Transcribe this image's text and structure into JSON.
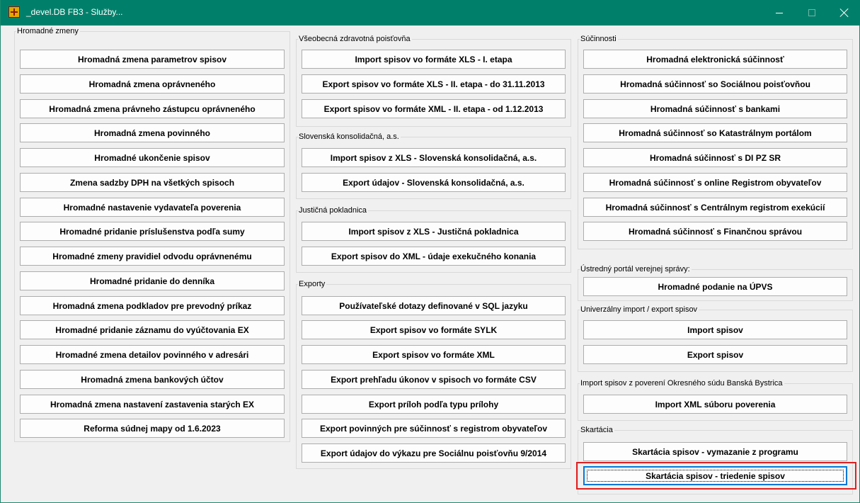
{
  "window": {
    "title": "_devel.DB FB3 - Služby..."
  },
  "groups": {
    "hromadne": {
      "label": "Hromadné zmeny",
      "buttons": [
        "Hromadná zmena parametrov spisov",
        "Hromadná zmena oprávneného",
        "Hromadná zmena právneho zástupcu oprávneného",
        "Hromadná zmena povinného",
        "Hromadné ukončenie spisov",
        "Zmena sadzby DPH na všetkých spisoch",
        "Hromadné nastavenie vydavateľa poverenia",
        "Hromadné pridanie príslušenstva podľa sumy",
        "Hromadné zmeny pravidiel odvodu oprávnenému",
        "Hromadné pridanie do denníka",
        "Hromadná zmena podkladov pre prevodný príkaz",
        "Hromadné pridanie záznamu do vyúčtovania EX",
        "Hromadné zmena detailov povinného v adresári",
        "Hromadná zmena bankových účtov",
        "Hromadná zmena nastavení zastavenia starých EX",
        "Reforma súdnej mapy od 1.6.2023"
      ]
    },
    "vszp": {
      "label": "Všeobecná zdravotná poisťovňa",
      "buttons": [
        "Import spisov vo formáte XLS - I. etapa",
        "Export spisov vo formáte XLS - II. etapa - do 31.11.2013",
        "Export spisov vo formáte XML - II. etapa - od 1.12.2013"
      ]
    },
    "sk": {
      "label": "Slovenská konsolidačná, a.s.",
      "buttons": [
        "Import spisov z XLS - Slovenská konsolidačná, a.s.",
        "Export údajov - Slovenská konsolidačná, a.s."
      ]
    },
    "jp": {
      "label": "Justičná pokladnica",
      "buttons": [
        "Import spisov z XLS - Justičná pokladnica",
        "Export spisov do XML - údaje exekučného konania"
      ]
    },
    "exporty": {
      "label": "Exporty",
      "buttons": [
        "Používateľské dotazy definované v SQL jazyku",
        "Export spisov vo formáte SYLK",
        "Export spisov vo formáte XML",
        "Export prehľadu úkonov v spisoch vo formáte CSV",
        "Export príloh podľa typu prílohy",
        "Export povinných pre súčinnosť s registrom obyvateľov",
        "Export údajov do výkazu pre Sociálnu poisťovňu 9/2014"
      ]
    },
    "sucinnosti": {
      "label": "Súčinnosti",
      "buttons": [
        "Hromadná elektronická súčinnosť",
        "Hromadná súčinnosť so Sociálnou poisťovňou",
        "Hromadná súčinnosť s bankami",
        "Hromadná súčinnosť so Katastrálnym portálom",
        "Hromadná súčinnosť s DI PZ SR",
        "Hromadná súčinnosť s online Registrom obyvateľov",
        "Hromadná súčinnosť s Centrálnym registrom exekúcií",
        "Hromadná súčinnosť s Finančnou správou"
      ]
    },
    "upvs": {
      "label": "Ústredný portál verejnej správy:",
      "buttons": [
        "Hromadné podanie na ÚPVS"
      ]
    },
    "univ": {
      "label": "Univerzálny import / export spisov",
      "buttons": [
        "Import spisov",
        "Export spisov"
      ]
    },
    "okresny": {
      "label": "Import spisov z poverení Okresného súdu Banská Bystrica",
      "buttons": [
        "Import XML súboru poverenia"
      ]
    },
    "skartacia": {
      "label": "Skartácia",
      "buttons": [
        "Skartácia spisov - vymazanie z programu",
        "Skartácia spisov - triedenie spisov"
      ]
    }
  }
}
